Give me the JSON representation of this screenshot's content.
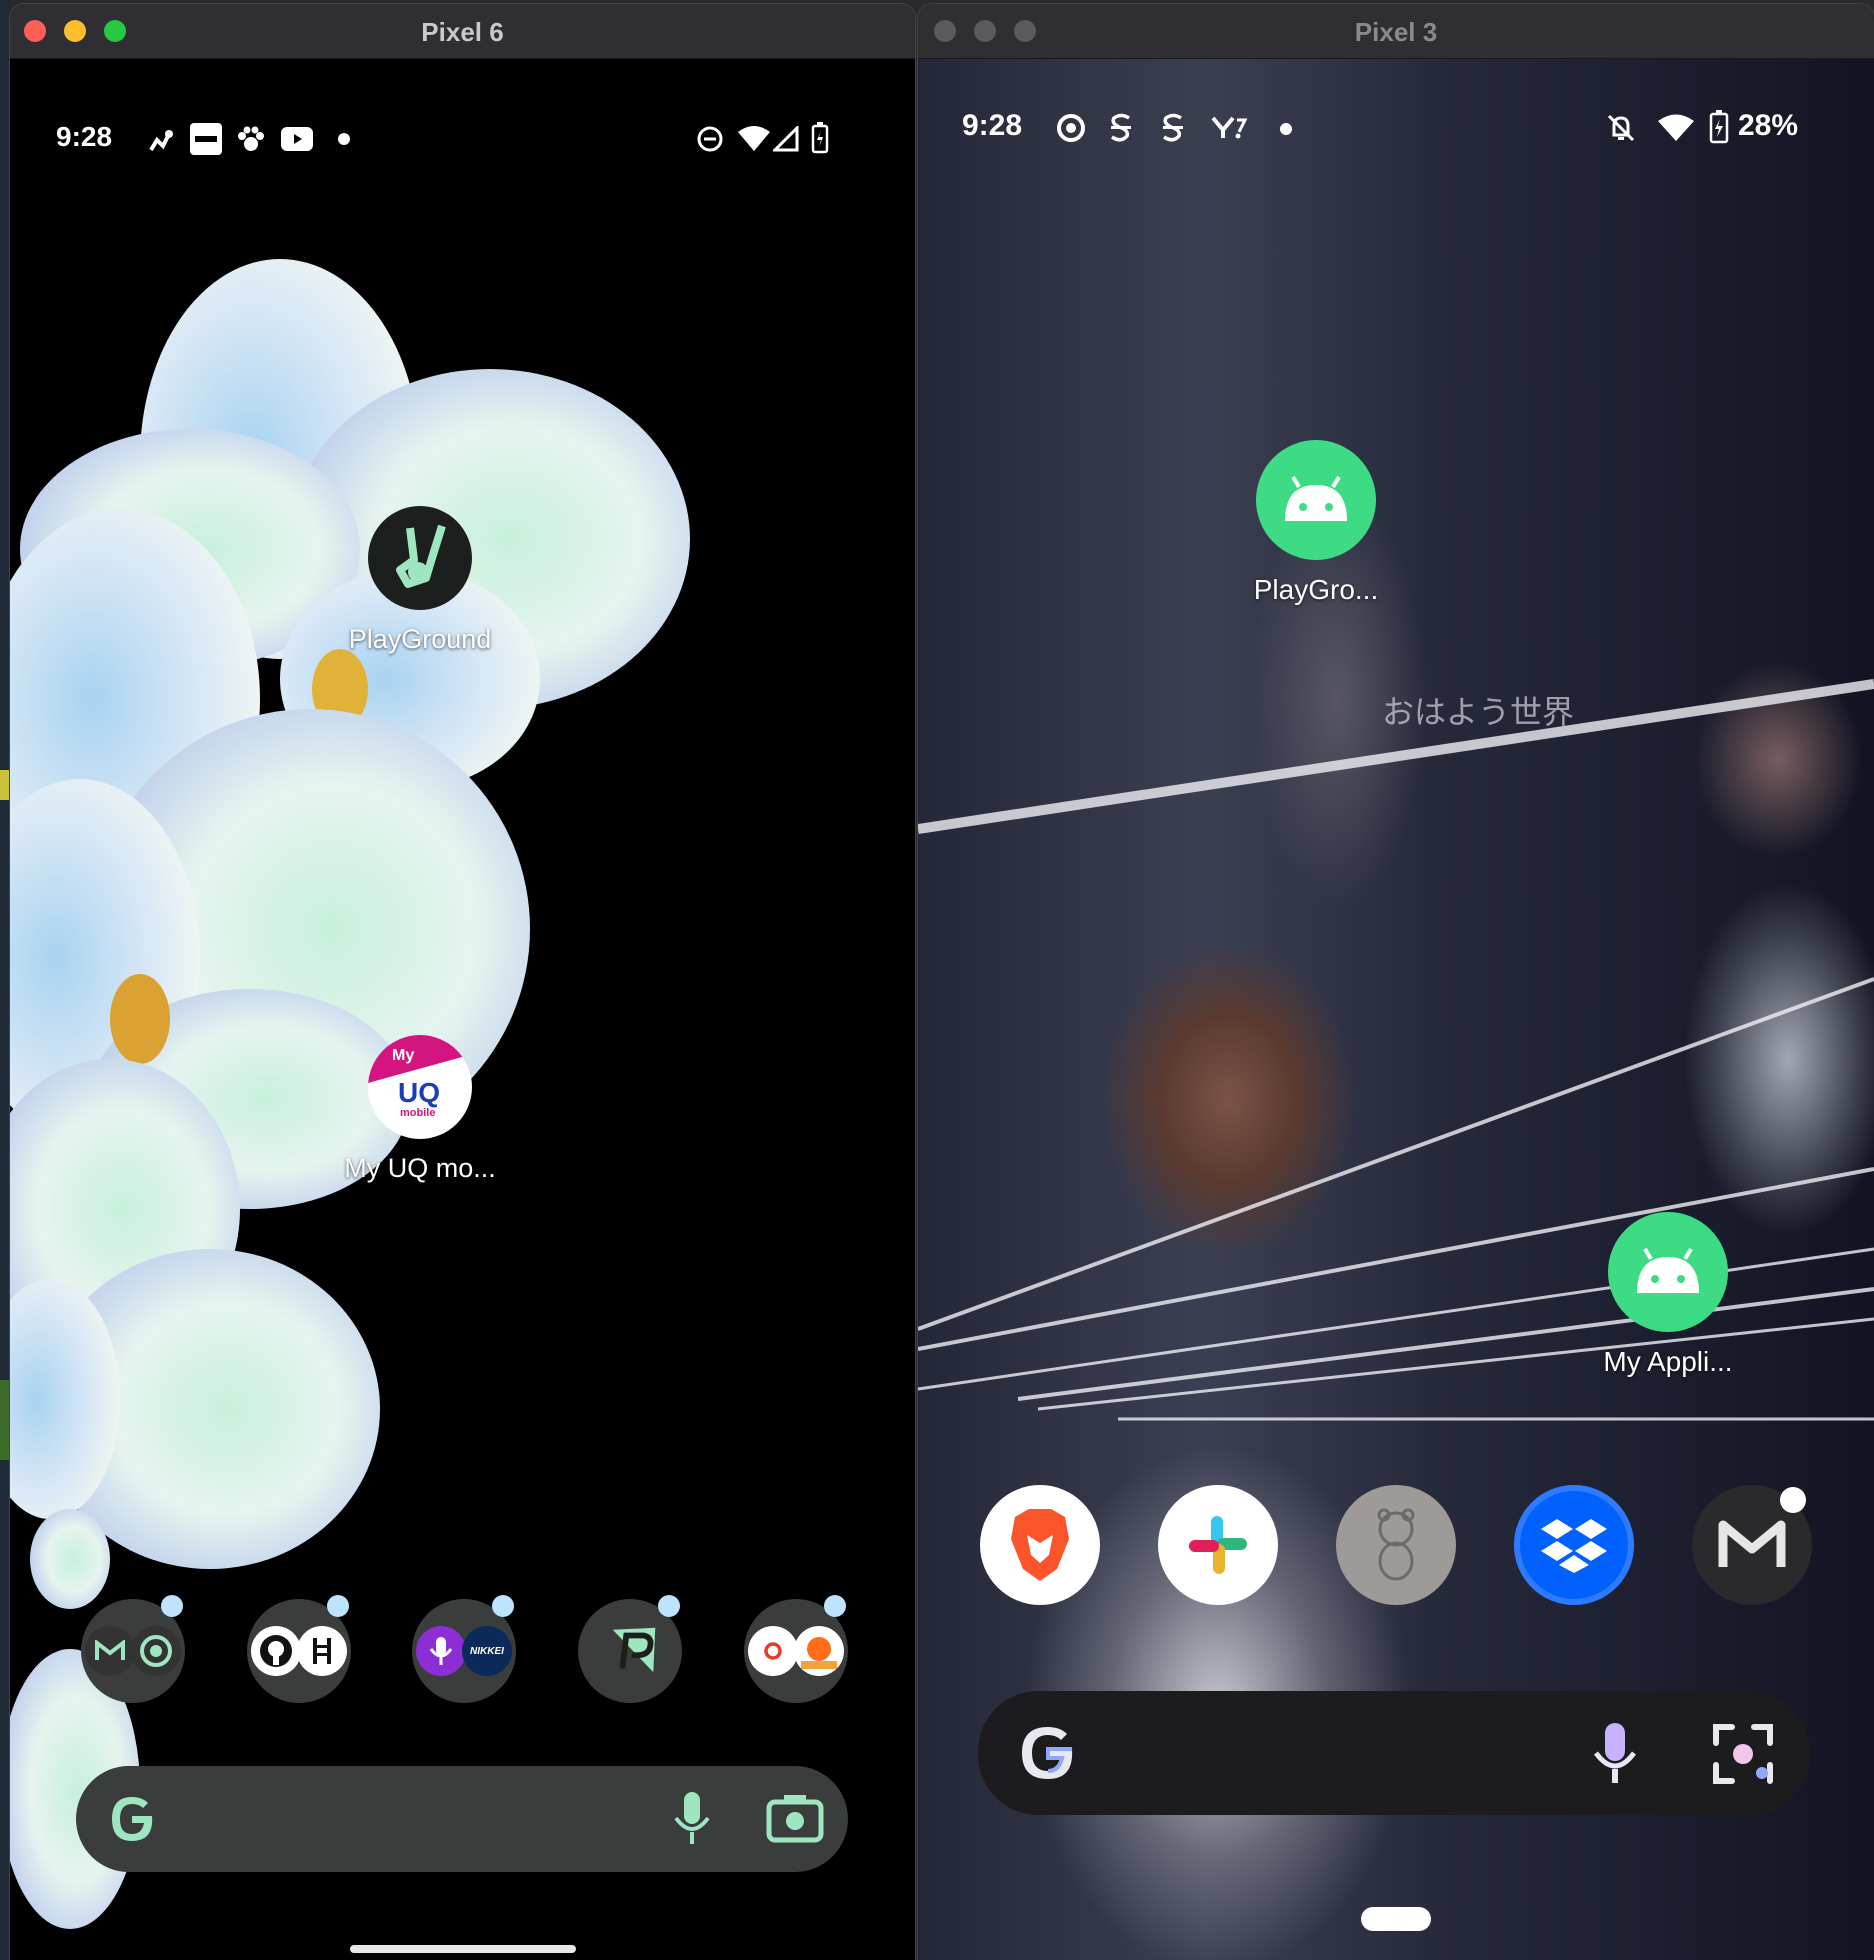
{
  "windows": [
    {
      "title": "Pixel 6",
      "status": {
        "time": "9:28"
      },
      "apps": [
        {
          "label": "PlayGround"
        },
        {
          "label": "My UQ mo...",
          "icon_text": {
            "my": "My",
            "uq": "UQ",
            "mobile": "mobile"
          }
        }
      ],
      "folders": [
        {
          "apps": [
            "gmail-icon",
            "chrome-icon"
          ]
        },
        {
          "apps": [
            "github-icon",
            "hatena-icon"
          ]
        },
        {
          "apps": [
            "podcasts-icon",
            "nikkei-icon"
          ],
          "nikkei_text": "NIKKEI"
        },
        {
          "apps": [
            "paypay-icon"
          ]
        },
        {
          "apps": [
            "record-icon",
            "orange-app-icon"
          ]
        }
      ],
      "search": {
        "icons": [
          "google-g-icon",
          "mic-icon",
          "camera-icon"
        ]
      }
    },
    {
      "title": "Pixel 3",
      "status": {
        "time": "9:28",
        "battery": "28%"
      },
      "apps": [
        {
          "label": "PlayGro..."
        },
        {
          "label": "My Appli..."
        }
      ],
      "wallpaper_text": "おはよう世界",
      "dock": [
        "brave-icon",
        "slack-icon",
        "bear-icon",
        "dropbox-icon",
        "gmail-icon"
      ],
      "search": {
        "icons": [
          "google-g-icon",
          "mic-icon",
          "lens-icon"
        ]
      }
    }
  ],
  "colors": {
    "close": "#ff5f57",
    "minimize": "#febc2e",
    "zoom": "#28c840",
    "inactive_light": "#5a5a5e",
    "android_green": "#3ddc84",
    "folder_badge": "#bde3ff"
  }
}
